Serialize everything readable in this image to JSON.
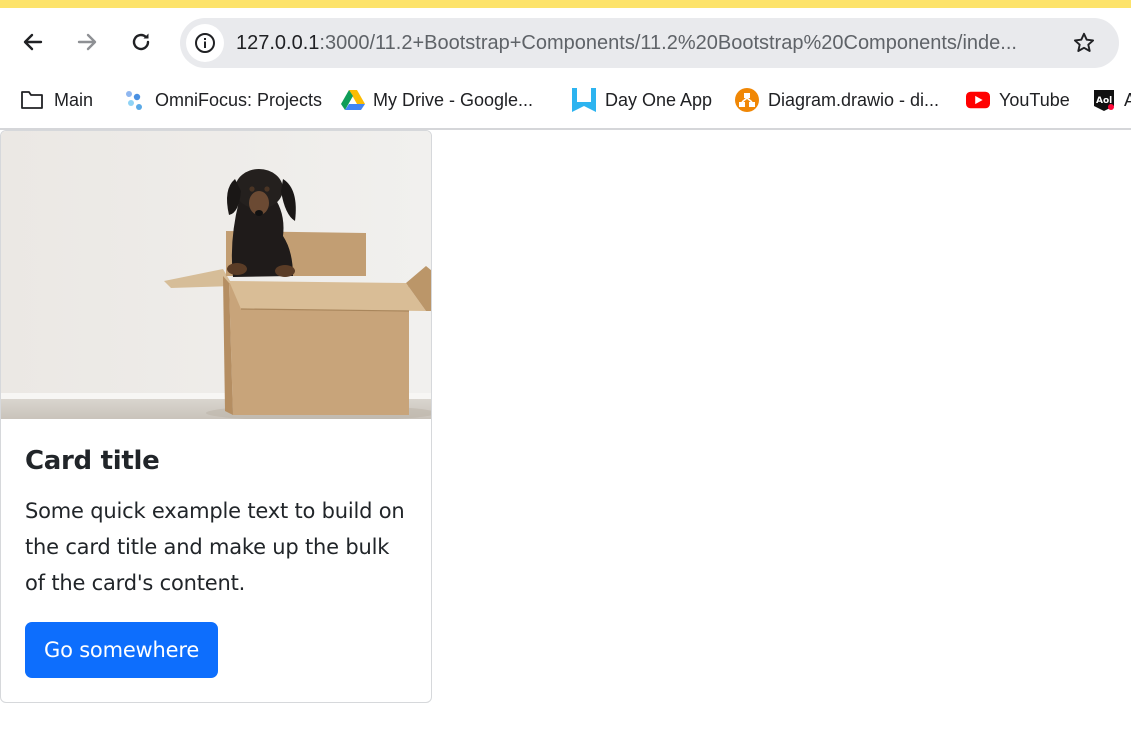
{
  "browser": {
    "url_host": "127.0.0.1",
    "url_rest": ":3000/11.2+Bootstrap+Components/11.2%20Bootstrap%20Components/inde...",
    "bookmarks": [
      {
        "label": "Main",
        "icon": "folder-icon"
      },
      {
        "label": "OmniFocus: Projects",
        "icon": "omnifocus-icon"
      },
      {
        "label": "My Drive - Google...",
        "icon": "google-drive-icon"
      },
      {
        "label": "Day One App",
        "icon": "day-one-icon"
      },
      {
        "label": "Diagram.drawio - di...",
        "icon": "drawio-icon"
      },
      {
        "label": "YouTube",
        "icon": "youtube-icon"
      },
      {
        "label": "A",
        "icon": "aol-icon"
      }
    ],
    "accent_strip_color": "#fde36b"
  },
  "card": {
    "image_alt": "Dachshund peeking out of a cardboard box",
    "title": "Card title",
    "text": "Some quick example text to build on the card title and make up the bulk of the card's content.",
    "button_label": "Go somewhere",
    "button_color": "#0d6efd"
  }
}
